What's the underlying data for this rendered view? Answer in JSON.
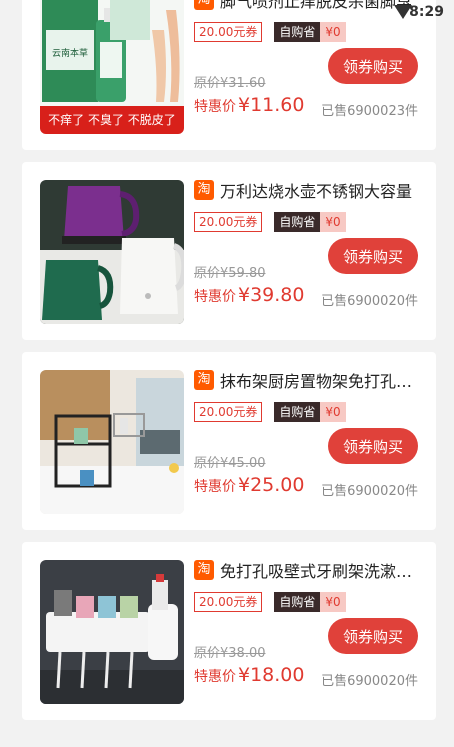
{
  "status": {
    "time": "8:29"
  },
  "products": [
    {
      "title": "脚气喷剂止痒脱皮杀菌脚臭",
      "coupon": "20.00元券",
      "self_buy_label": "自购省",
      "self_buy_amount": "¥0",
      "original_price": "原价¥31.60",
      "price_label": "特惠价",
      "price": "¥11.60",
      "sold": "已售6900023件",
      "buy_label": "领券购买",
      "image_banner": "不痒了 不臭了 不脱皮了",
      "image_brand": "云南本草"
    },
    {
      "title": "万利达烧水壶不锈钢大容量",
      "coupon": "20.00元券",
      "self_buy_label": "自购省",
      "self_buy_amount": "¥0",
      "original_price": "原价¥59.80",
      "price_label": "特惠价",
      "price": "¥39.80",
      "sold": "已售6900020件",
      "buy_label": "领券购买"
    },
    {
      "title": "抹布架厨房置物架免打孔挂架",
      "coupon": "20.00元券",
      "self_buy_label": "自购省",
      "self_buy_amount": "¥0",
      "original_price": "原价¥45.00",
      "price_label": "特惠价",
      "price": "¥25.00",
      "sold": "已售6900020件",
      "buy_label": "领券购买"
    },
    {
      "title": "免打孔吸壁式牙刷架洗漱杯套装",
      "coupon": "20.00元券",
      "self_buy_label": "自购省",
      "self_buy_amount": "¥0",
      "original_price": "原价¥38.00",
      "price_label": "特惠价",
      "price": "¥18.00",
      "sold": "已售6900020件",
      "buy_label": "领券购买"
    }
  ],
  "icons": {
    "platform": "taobao-icon",
    "wifi": "wifi-icon"
  },
  "colors": {
    "accent": "#e0413a",
    "taobao": "#ff5a00"
  }
}
